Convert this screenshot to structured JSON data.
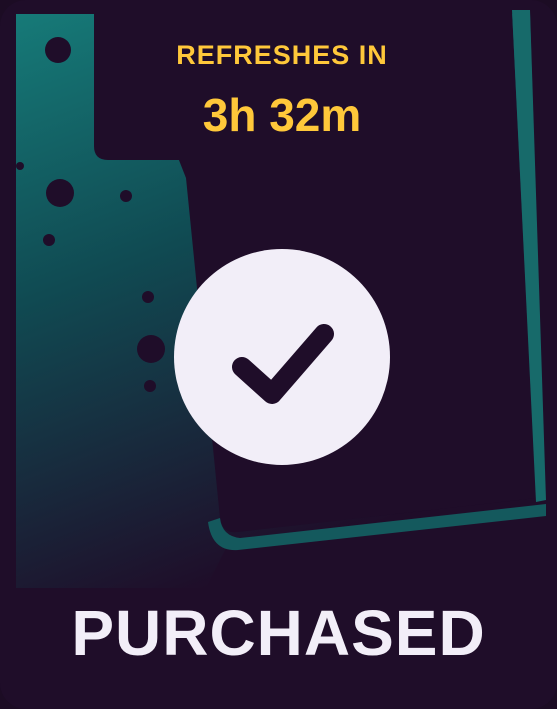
{
  "card": {
    "refresh_label": "REFRESHES IN",
    "refresh_time": "3h 32m",
    "status": "PURCHASED"
  },
  "icons": {
    "check": "checkmark-icon"
  },
  "colors": {
    "background": "#1f0d29",
    "accent_teal": "#1a6b6a",
    "timer_text": "#ffc83a",
    "badge": "#f2eef8",
    "check_stroke": "#1f0d29"
  }
}
